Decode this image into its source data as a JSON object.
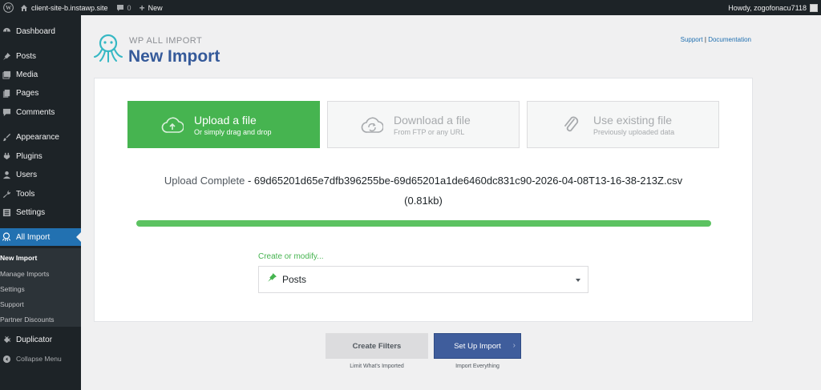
{
  "admin_bar": {
    "site_name": "client-site-b.instawp.site",
    "comments_count": "0",
    "new_label": "New",
    "howdy": "Howdy, zogofonacu7118"
  },
  "sidebar": {
    "items": [
      {
        "label": "Dashboard",
        "icon": "dashboard-icon"
      },
      {
        "label": "Posts",
        "icon": "pushpin-icon"
      },
      {
        "label": "Media",
        "icon": "media-icon"
      },
      {
        "label": "Pages",
        "icon": "pages-icon"
      },
      {
        "label": "Comments",
        "icon": "comments-icon"
      },
      {
        "label": "Appearance",
        "icon": "paintbrush-icon"
      },
      {
        "label": "Plugins",
        "icon": "plugins-icon"
      },
      {
        "label": "Users",
        "icon": "users-icon"
      },
      {
        "label": "Tools",
        "icon": "wrench-icon"
      },
      {
        "label": "Settings",
        "icon": "settings-icon"
      },
      {
        "label": "All Import",
        "icon": "all-import-icon"
      },
      {
        "label": "Duplicator",
        "icon": "duplicator-icon"
      }
    ],
    "submenu": [
      "New Import",
      "Manage Imports",
      "Settings",
      "Support",
      "Partner Discounts"
    ],
    "collapse_label": "Collapse Menu"
  },
  "header": {
    "brand_small": "WP ALL IMPORT",
    "title": "New Import",
    "support_link": "Support",
    "separator": "|",
    "documentation_link": "Documentation"
  },
  "options": [
    {
      "title": "Upload a file",
      "subtitle": "Or simply drag and drop",
      "icon": "cloud-upload-icon",
      "active": true
    },
    {
      "title": "Download a file",
      "subtitle": "From FTP or any URL",
      "icon": "cloud-sync-icon",
      "active": false
    },
    {
      "title": "Use existing file",
      "subtitle": "Previously uploaded data",
      "icon": "paperclip-icon",
      "active": false
    }
  ],
  "upload": {
    "status_label": "Upload Complete",
    "filename": "- 69d65201d65e7dfb396255be-69d65201a1de6460dc831c90-2026-04-08T13-16-38-213Z.csv",
    "size": "(0.81kb)",
    "progress_fraction": 1.0
  },
  "create_modify": {
    "label": "Create or modify...",
    "selected": "Posts"
  },
  "buttons": {
    "filters": "Create Filters",
    "filters_caption": "Limit What's Imported",
    "setup": "Set Up Import",
    "setup_caption": "Import Everything"
  },
  "colors": {
    "admin_dark": "#1d2327",
    "wp_blue": "#2271b1",
    "success_green": "#46b450",
    "brand_blue": "#355a9a",
    "setup_button": "#3f5d9c"
  }
}
